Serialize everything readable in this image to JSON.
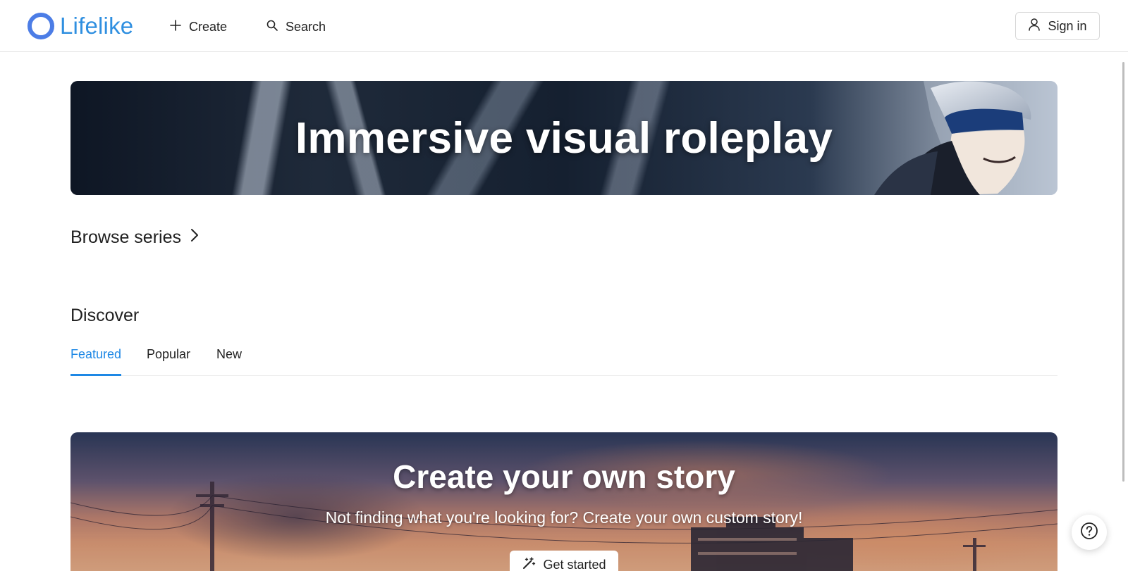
{
  "header": {
    "brand": "Lifelike",
    "nav": {
      "create_label": "Create",
      "search_label": "Search"
    },
    "signin_label": "Sign in"
  },
  "hero": {
    "title": "Immersive visual roleplay"
  },
  "browse": {
    "label": "Browse series"
  },
  "discover": {
    "title": "Discover",
    "tabs": [
      {
        "label": "Featured",
        "active": true
      },
      {
        "label": "Popular",
        "active": false
      },
      {
        "label": "New",
        "active": false
      }
    ]
  },
  "story_banner": {
    "title": "Create your own story",
    "subtitle": "Not finding what you're looking for? Create your own custom story!",
    "cta_label": "Get started"
  },
  "colors": {
    "accent": "#1e88e5",
    "brand": "#2f8fe0",
    "logo_ring": "#4c7de6"
  },
  "icons": {
    "logo": "ring-logo-icon",
    "create": "plus-icon",
    "search": "search-icon",
    "signin": "user-icon",
    "browse": "chevron-right-icon",
    "cta": "magic-wand-icon",
    "help": "help-icon"
  }
}
